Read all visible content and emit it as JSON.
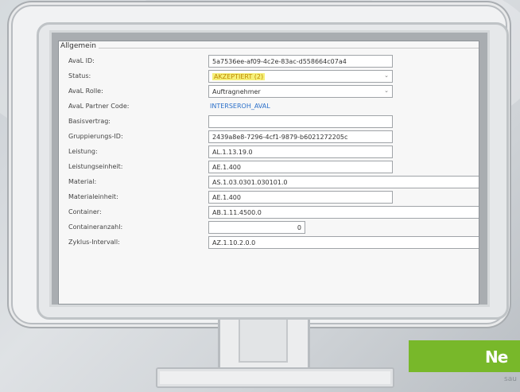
{
  "panel": {
    "title": "Allgemein"
  },
  "rows": [
    {
      "label": "AvaL ID:",
      "value": "5a7536ee-af09-4c2e-83ac-d558664c07a4",
      "kind": "text"
    },
    {
      "label": "Status:",
      "value": "AKZEPTIERT (2)",
      "kind": "select-status"
    },
    {
      "label": "AvaL Rolle:",
      "value": "Auftragnehmer",
      "kind": "select"
    },
    {
      "label": "AvaL Partner Code:",
      "value": "INTERSEROH_AVAL",
      "kind": "link"
    },
    {
      "label": "Basisvertrag:",
      "value": "",
      "kind": "text"
    },
    {
      "label": "Gruppierungs-ID:",
      "value": "2439a8e8-7296-4cf1-9879-b6021272205c",
      "kind": "text"
    },
    {
      "label": "Leistung:",
      "value": "AL.1.13.19.0",
      "kind": "text"
    },
    {
      "label": "Leistungseinheit:",
      "value": "AE.1.400",
      "kind": "text"
    },
    {
      "label": "Material:",
      "value": "AS.1.03.0301.030101.0",
      "kind": "wide"
    },
    {
      "label": "Materialeinheit:",
      "value": "AE.1.400",
      "kind": "text"
    },
    {
      "label": "Container:",
      "value": "AB.1.11.4500.0",
      "kind": "wide"
    },
    {
      "label": "Containeranzahl:",
      "value": "0",
      "kind": "number"
    },
    {
      "label": "Zyklus-Intervall:",
      "value": "AZ.1.10.2.0.0",
      "kind": "wide"
    }
  ],
  "brand": {
    "logo_text": "Ne",
    "sub_text": "sau",
    "color": "#78b82a"
  },
  "colors": {
    "status_highlight": "#f5f07a",
    "link": "#2a6fc9"
  }
}
